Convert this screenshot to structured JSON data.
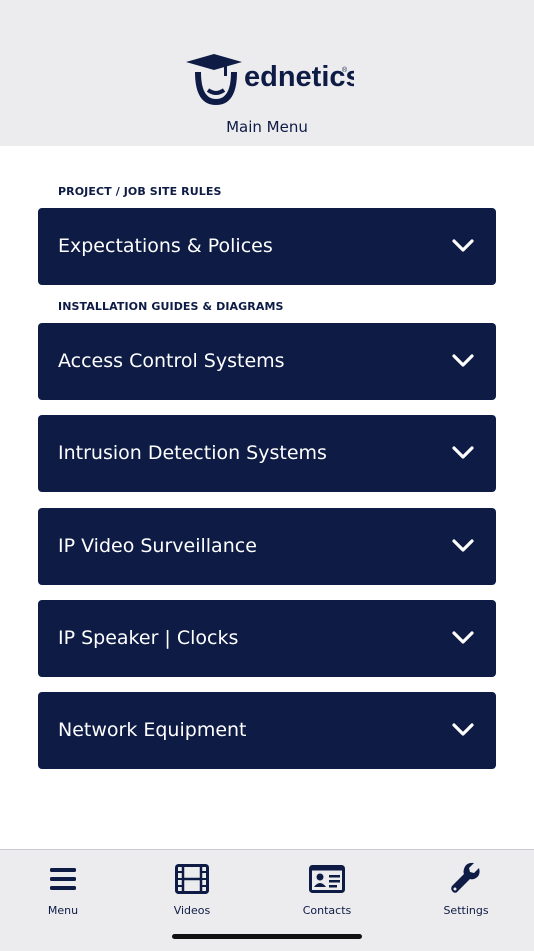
{
  "header": {
    "logo_text": "ednetics",
    "title": "Main Menu"
  },
  "sections": [
    {
      "heading": "PROJECT / JOB SITE RULES"
    },
    {
      "heading": "INSTALLATION GUIDES & DIAGRAMS"
    }
  ],
  "accordions": [
    {
      "label": "Expectations & Polices",
      "expanded": false
    },
    {
      "label": "Access Control Systems",
      "expanded": false
    },
    {
      "label": "Intrusion Detection Systems",
      "expanded": false
    },
    {
      "label": "IP Video Surveillance",
      "expanded": false
    },
    {
      "label": "IP Speaker | Clocks",
      "expanded": false
    },
    {
      "label": "Network Equipment",
      "expanded": false
    }
  ],
  "tabs": [
    {
      "label": "Menu",
      "icon": "hamburger-icon"
    },
    {
      "label": "Videos",
      "icon": "film-icon"
    },
    {
      "label": "Contacts",
      "icon": "contact-card-icon"
    },
    {
      "label": "Settings",
      "icon": "wrench-icon"
    }
  ],
  "colors": {
    "brand_navy": "#0d1b45",
    "header_bg": "#ececee",
    "page_bg": "#ffffff"
  }
}
